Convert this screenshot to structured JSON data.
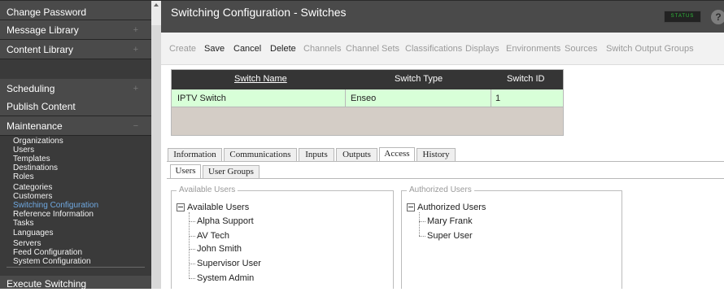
{
  "sidebar": {
    "main_items": [
      {
        "label": "Change Password",
        "plus": ""
      },
      {
        "label": "Message Library",
        "plus": "+"
      },
      {
        "label": "Content Library",
        "plus": "+"
      },
      {
        "label": "Scheduling",
        "plus": "+"
      },
      {
        "label": "Publish Content",
        "plus": ""
      },
      {
        "label": "Maintenance",
        "plus": "−"
      }
    ],
    "sub_items": [
      "Organizations",
      "Users",
      "Templates",
      "Destinations",
      "Roles",
      "Categories",
      "Customers",
      "Switching Configuration",
      "Reference Information",
      "Tasks",
      "Languages",
      "Servers",
      "Feed Configuration",
      "System Configuration"
    ],
    "active_sub": "Switching Configuration",
    "bottom_item": "Execute Switching"
  },
  "header": {
    "title": "Switching Configuration - Switches",
    "status_label": "STATUS",
    "help_label": "?"
  },
  "toolbar": {
    "items": [
      {
        "label": "Create",
        "enabled": false
      },
      {
        "label": "Save",
        "enabled": true
      },
      {
        "label": "Cancel",
        "enabled": true
      },
      {
        "label": "Delete",
        "enabled": true
      },
      {
        "label": "Channels",
        "enabled": false
      },
      {
        "label": "Channel Sets",
        "enabled": false
      },
      {
        "label": "Classifications",
        "enabled": false
      },
      {
        "label": "Displays",
        "enabled": false
      },
      {
        "label": "Environments",
        "enabled": false
      },
      {
        "label": "Sources",
        "enabled": false
      },
      {
        "label": "Switch Output Groups",
        "enabled": false
      }
    ]
  },
  "table": {
    "headers": [
      "Switch Name",
      "Switch Type",
      "Switch ID"
    ],
    "rows": [
      [
        "IPTV Switch",
        "Enseo",
        "1"
      ]
    ]
  },
  "tabs": {
    "items": [
      "Information",
      "Communications",
      "Inputs",
      "Outputs",
      "Access",
      "History"
    ],
    "active": "Access"
  },
  "subtabs": {
    "items": [
      "Users",
      "User Groups"
    ],
    "active": "Users"
  },
  "available": {
    "legend": "Available Users",
    "root": "Available Users",
    "items": [
      "Alpha Support",
      "AV Tech",
      "John Smith",
      "Supervisor User",
      "System Admin"
    ]
  },
  "authorized": {
    "legend": "Authorized Users",
    "root": "Authorized Users",
    "items": [
      "Mary Frank",
      "Super User"
    ]
  },
  "colors": {
    "sidebar_bg": "#3a3a3a",
    "active_link": "#6fa8e0",
    "selected_row": "#d8ffd8",
    "status_green": "#2fbf3a"
  }
}
